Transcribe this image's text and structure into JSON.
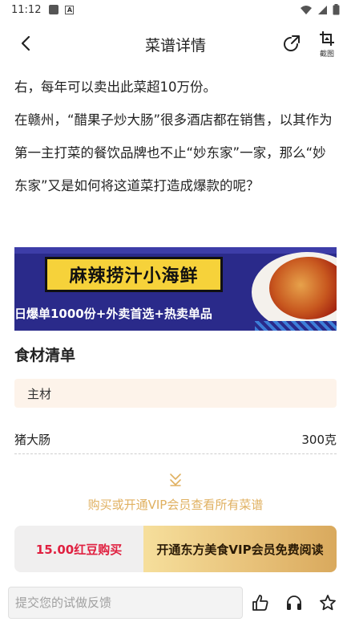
{
  "status_bar": {
    "time": "11:12",
    "badge_letter": "A"
  },
  "header": {
    "title": "菜谱详情",
    "crop_label": "截图"
  },
  "article": {
    "paragraphs": [
      "右，每年可以卖出此菜超10万份。",
      "在赣州，“醋果子炒大肠”很多酒店都在销售，以其作为第一主打菜的餐饮品牌也不止“妙东家”一家，那么“妙东家”又是如何将这道菜打造成爆款的呢？"
    ]
  },
  "banner": {
    "title": "麻辣捞汁小海鲜",
    "subtitle": "日爆单1000份+外卖首选+热卖单品",
    "colors": {
      "background": "#2a2a8a",
      "title_box": "#f6d23a"
    }
  },
  "ingredients": {
    "section_title": "食材清单",
    "main_label": "主材",
    "items": [
      {
        "name": "猪大肠",
        "amount": "300克"
      }
    ]
  },
  "unlock": {
    "text": "购买或开通VIP会员查看所有菜谱"
  },
  "purchase": {
    "buy_label": "15.00红豆购买",
    "vip_label": "开通东方美食VIP会员免费阅读",
    "colors": {
      "buy_text": "#e02040",
      "vip_gold": "#e8c27a"
    }
  },
  "bottom": {
    "feedback_placeholder": "提交您的试做反馈",
    "icons": [
      "thumbs-up-icon",
      "headphones-icon",
      "star-icon"
    ]
  }
}
